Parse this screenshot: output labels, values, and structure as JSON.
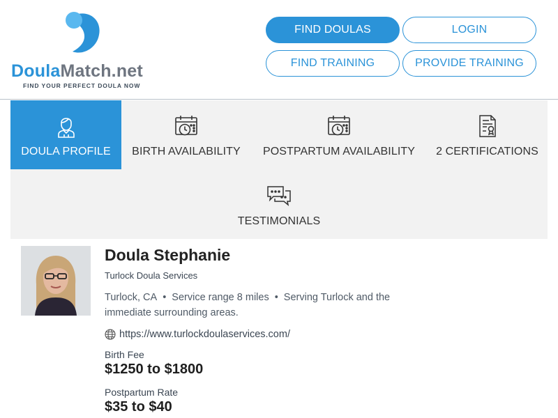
{
  "logo": {
    "brand": "Doula",
    "rest": "Match.net",
    "tagline": "FIND YOUR PERFECT DOULA NOW",
    "brand_color": "#2b93d8"
  },
  "nav": {
    "find_doulas": "FIND DOULAS",
    "login": "LOGIN",
    "find_training": "FIND TRAINING",
    "provide_training": "PROVIDE TRAINING"
  },
  "tabs": {
    "profile": {
      "label": "DOULA PROFILE",
      "icon": "doula-person-icon",
      "active": true
    },
    "birth": {
      "label": "BIRTH AVAILABILITY",
      "icon": "calendar-clock-icon"
    },
    "postpartum": {
      "label": "POSTPARTUM AVAILABILITY",
      "icon": "calendar-clock-icon"
    },
    "certifications": {
      "label": "2 CERTIFICATIONS",
      "icon": "certificate-icon"
    },
    "testimonials": {
      "label": "TESTIMONIALS",
      "icon": "chat-bubbles-icon"
    }
  },
  "profile": {
    "name": "Doula Stephanie",
    "company": "Turlock Doula Services",
    "city": "Turlock, CA",
    "range": "Service range 8 miles",
    "serving": "Serving Turlock and the immediate surrounding areas.",
    "website": "https://www.turlockdoulaservices.com/",
    "birth_fee_label": "Birth Fee",
    "birth_fee": "$1250 to $1800",
    "postpartum_label": "Postpartum Rate",
    "postpartum_rate": "$35 to $40"
  },
  "colors": {
    "accent": "#2b93d8",
    "tab_bg": "#f2f2f2"
  }
}
